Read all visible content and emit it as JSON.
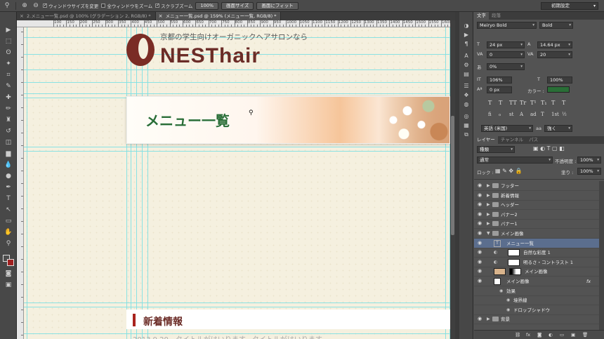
{
  "options_bar": {
    "resize_windows": "ウィンドウサイズを変更",
    "zoom_all_windows": "全ウィンドウをズーム",
    "scrubby_zoom": "スクラブズーム",
    "zoom_level": "100%",
    "actual_pixels": "画面サイズ",
    "fit_screen": "画面にフィット",
    "workspace": "初期設定"
  },
  "document_tabs": [
    {
      "label": "2.メニュー一覧.psd @ 100% (グラデーション 2, RGB/8) *",
      "active": false
    },
    {
      "label": "メニュー一覧.psd @ 159% (メニュー一覧, RGB/8) *",
      "active": true
    }
  ],
  "ruler_top_numbers": [
    "100",
    "150",
    "200",
    "250",
    "300",
    "350",
    "400",
    "450",
    "500",
    "550",
    "600",
    "650",
    "700",
    "750",
    "800",
    "850",
    "900",
    "950",
    "1000",
    "1050",
    "1100",
    "1150",
    "1200",
    "1250",
    "1300",
    "1350",
    "1400",
    "1450",
    "1500",
    "1550",
    "1600",
    "1650",
    "1700",
    "1750"
  ],
  "page": {
    "tagline": "京都の学生向けオーガニックヘアサロンなら",
    "brand": "NESThair",
    "banner_title": "メニュー一覧",
    "news_heading": "新着情報",
    "news_line": "2013.9.20　タイトルがはいります。タイトルがはいります。",
    "brand_color": "#6b2c27",
    "heading_green": "#2a6e37"
  },
  "character_panel": {
    "tabs": [
      "文字",
      "段落"
    ],
    "font_family": "Meiryo Bold",
    "font_style": "Bold",
    "font_size": "24 px",
    "leading": "14.64 px",
    "kerning": "0",
    "tracking": "20",
    "tsume": "0%",
    "vertical_scale": "106%",
    "horizontal_scale": "100%",
    "baseline_shift": "0 px",
    "color_label": "カラー :",
    "color": "#2a6e37",
    "style_buttons": [
      "T",
      "T",
      "TT",
      "Tr",
      "T¹",
      "T₁",
      "T",
      "T"
    ],
    "opentype_buttons": [
      "fi",
      "ℴ",
      "st",
      "A",
      "ad",
      "T",
      "1st",
      "½"
    ],
    "language": "英語 (米国)",
    "antialias_prefix": "aa",
    "antialias": "強く"
  },
  "layers_panel": {
    "tabs": [
      "レイヤー",
      "チャンネル",
      "パス"
    ],
    "filter_kind": "種類",
    "blend_mode": "通常",
    "opacity_label": "不透明度 :",
    "opacity": "100%",
    "lock_label": "ロック :",
    "fill_label": "塗り :",
    "fill": "100%",
    "layers": [
      {
        "name": "フッター",
        "type": "group",
        "indent": 0
      },
      {
        "name": "新着情報",
        "type": "group",
        "indent": 0
      },
      {
        "name": "ヘッダー",
        "type": "group",
        "indent": 0
      },
      {
        "name": "バナー2",
        "type": "group",
        "indent": 0
      },
      {
        "name": "バナー1",
        "type": "group",
        "indent": 0
      },
      {
        "name": "メイン画像",
        "type": "group-open",
        "indent": 0
      },
      {
        "name": "メニュー一覧",
        "type": "text",
        "indent": 1,
        "selected": true
      },
      {
        "name": "自然な彩度 1",
        "type": "adjust",
        "indent": 1
      },
      {
        "name": "明るさ・コントラスト 1",
        "type": "adjust",
        "indent": 1
      },
      {
        "name": "メイン画像",
        "type": "image",
        "indent": 1
      },
      {
        "name": "メイン画像",
        "type": "shape",
        "indent": 1,
        "fx": "fx"
      },
      {
        "name": "効果",
        "type": "effects",
        "indent": 2
      },
      {
        "name": "境界線",
        "type": "effect",
        "indent": 3
      },
      {
        "name": "ドロップシャドウ",
        "type": "effect",
        "indent": 3
      },
      {
        "name": "背景",
        "type": "group",
        "indent": 0
      }
    ]
  }
}
